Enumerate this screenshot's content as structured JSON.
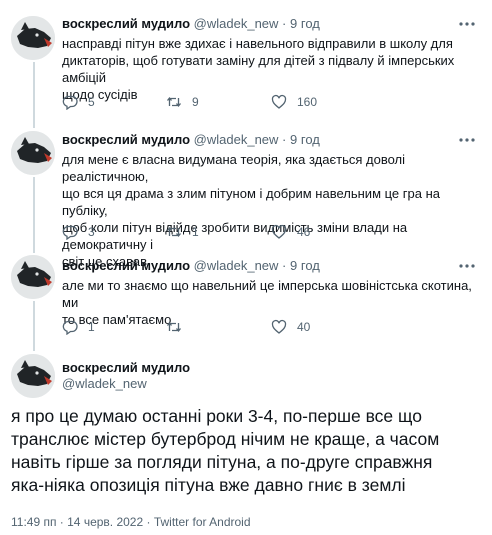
{
  "tweets": [
    {
      "name": "воскреслий мудило",
      "handle": "@wladek_new",
      "dot": "·",
      "time": "9 год",
      "text": "насправді пітун вже здихає і навельного відправили в школу для\nдиктаторів, щоб готувати заміну для дітей з підвалу й імперських амбіцій\nщодо сусідів",
      "replies": "5",
      "retweets": "9",
      "likes": "160"
    },
    {
      "name": "воскреслий мудило",
      "handle": "@wladek_new",
      "dot": "·",
      "time": "9 год",
      "text": "для мене є власна видумана теорія, яка здається доволі реалістичною,\nщо вся ця драма з злим пітуном і добрим навельним це гра на публіку,\nщоб коли пітун відійде зробити видимість зміни влади на демократичну і\nсвіт це схавав",
      "replies": "3",
      "retweets": "1",
      "likes": "46"
    },
    {
      "name": "воскреслий мудило",
      "handle": "@wladek_new",
      "dot": "·",
      "time": "9 год",
      "text": "але ми то знаємо що навельний це імперська шовіністська скотина, ми\nто все пам'ятаємо",
      "replies": "1",
      "retweets": "",
      "likes": "40"
    }
  ],
  "main": {
    "name": "воскреслий мудило",
    "handle": "@wladek_new",
    "text": "я про це думаю останні роки 3-4, по-перше все що\nтранслює містер бутерброд нічим не краще, а часом\nнавіть гірше за погляди пітуна, а по-друге справжня\nяка-ніяка опозиція пітуна вже давно гниє в землі",
    "meta": "11:49 пп · 14 черв. 2022 · Twitter for Android"
  }
}
